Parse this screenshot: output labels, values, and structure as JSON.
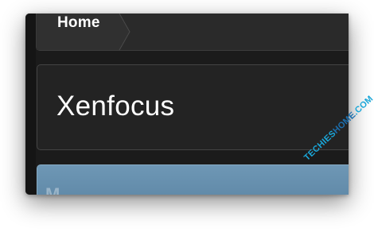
{
  "nav": {
    "breadcrumb_home": "Home"
  },
  "header": {
    "site_title": "Xenfocus"
  },
  "panel": {
    "partial_text": "M"
  },
  "watermark": {
    "part1": "TECHIES",
    "part2": "HOME",
    "part3": ".COM"
  },
  "colors": {
    "background": "#1b1b1b",
    "panel_blue": "#6e97b5",
    "watermark_light": "#1aa6d8",
    "watermark_dark": "#1c6fae"
  }
}
